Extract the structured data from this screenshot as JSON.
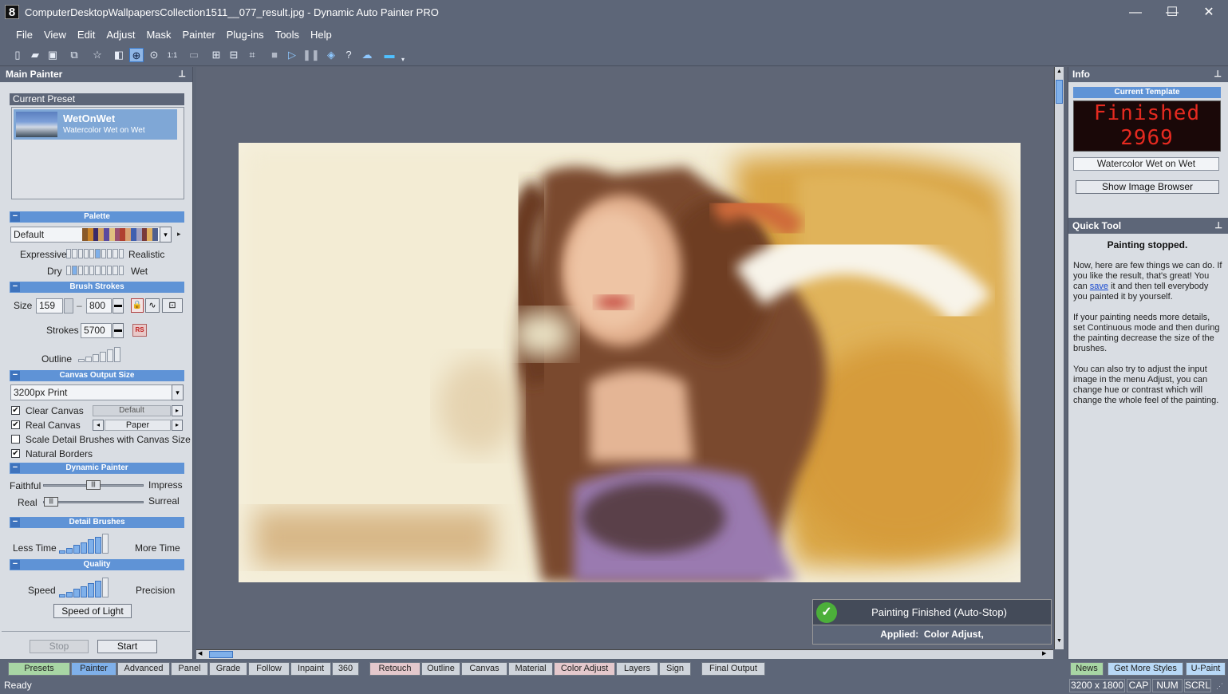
{
  "window": {
    "logo": "8",
    "title": "ComputerDesktopWallpapersCollection1511__077_result.jpg - Dynamic Auto Painter PRO",
    "minimize_icon": "—",
    "maximize_icon": "☐",
    "close_icon": "✕"
  },
  "menu": [
    "File",
    "View",
    "Edit",
    "Adjust",
    "Mask",
    "Painter",
    "Plug-ins",
    "Tools",
    "Help"
  ],
  "toolbar": {
    "icons": [
      "new-file-icon",
      "open-folder-icon",
      "save-icon",
      "save-as-icon",
      "favorite-star-icon",
      "compare-icon",
      "zoom-fit-icon",
      "zoom-in-icon",
      "actual-size-icon",
      "disabled-icon",
      "layout-1-icon",
      "layout-2-icon",
      "crop-icon",
      "stop-icon",
      "play-icon",
      "pause-icon",
      "shape-icon",
      "help-icon",
      "cloud-upload-icon",
      "monitor-icon"
    ],
    "actual_size_label": "1:1"
  },
  "left_panel": {
    "title": "Main Painter",
    "current_preset_label": "Current Preset",
    "preset": {
      "name": "WetOnWet",
      "description": "Watercolor Wet on Wet"
    },
    "palette": {
      "header": "Palette",
      "selected": "Default",
      "colors": [
        "#8a5a2a",
        "#c9842a",
        "#3a2a6a",
        "#d0a060",
        "#5a4aa0",
        "#e0c080",
        "#9a5070",
        "#b04030",
        "#d8a070",
        "#4060b0",
        "#a0a0c0",
        "#7a3a3a",
        "#e0b060",
        "#506090"
      ],
      "expressive_label": "Expressive",
      "realistic_label": "Realistic",
      "dry_label": "Dry",
      "wet_label": "Wet",
      "expressive_level": 5,
      "dry_level": 1
    },
    "brush_strokes": {
      "header": "Brush Strokes",
      "size_label": "Size",
      "size_min": "159",
      "size_dash": "–",
      "size_max": "800",
      "strokes_label": "Strokes",
      "strokes_value": "5700",
      "rs_badge": "RS",
      "outline_label": "Outline"
    },
    "canvas_output": {
      "header": "Canvas Output Size",
      "selected": "3200px Print",
      "clear_canvas_label": "Clear Canvas",
      "clear_canvas_checked": true,
      "clear_canvas_value": "Default",
      "real_canvas_label": "Real Canvas",
      "real_canvas_checked": true,
      "real_canvas_value": "Paper",
      "scale_detail_label": "Scale Detail Brushes with Canvas Size",
      "scale_detail_checked": false,
      "natural_borders_label": "Natural Borders",
      "natural_borders_checked": true
    },
    "dynamic_painter": {
      "header": "Dynamic Painter",
      "faithful_label": "Faithful",
      "impress_label": "Impress",
      "real_label": "Real",
      "surreal_label": "Surreal",
      "faithful_value": 0.5,
      "real_value": 0.08
    },
    "detail_brushes": {
      "header": "Detail Brushes",
      "less_time_label": "Less Time",
      "more_time_label": "More Time",
      "level": 5
    },
    "quality": {
      "header": "Quality",
      "speed_label": "Speed",
      "precision_label": "Precision",
      "level": 5,
      "preset_button": "Speed of Light"
    },
    "stop_button": "Stop",
    "start_button": "Start"
  },
  "notification": {
    "title": "Painting Finished (Auto-Stop)",
    "applied_label": "Applied:",
    "applied_value": "Color Adjust,"
  },
  "info_panel": {
    "title": "Info",
    "current_template_label": "Current Template",
    "led_line1": "Finished",
    "led_line2": "2969",
    "template_name": "Watercolor Wet on Wet",
    "show_browser_button": "Show Image Browser"
  },
  "quick_tool": {
    "title": "Quick Tool",
    "heading": "Painting stopped.",
    "para1_before": "Now, here are few things we can do. If you like the result, that's great! You can ",
    "para1_link": "save",
    "para1_after": " it and then tell everybody you painted it by yourself.",
    "para2": "If your painting needs more details, set Continuous mode and then during the painting decrease the size of the brushes.",
    "para3": "You can also try to adjust the input image in the menu Adjust, you can change hue or contrast which will change the whole feel of the painting."
  },
  "tabs": [
    "Presets",
    "Painter",
    "Advanced",
    "Panel",
    "Grade",
    "Follow",
    "Inpaint",
    "360",
    "Retouch",
    "Outline",
    "Canvas",
    "Material",
    "Color Adjust",
    "Layers",
    "Sign",
    "Final Output"
  ],
  "active_tab": "Painter",
  "right_tabs": [
    "News",
    "Get More Styles",
    "U-Paint"
  ],
  "status": {
    "text": "Ready",
    "dimensions": "3200 x 1800",
    "cap": "CAP",
    "num": "NUM",
    "scrl": "SCRL"
  }
}
